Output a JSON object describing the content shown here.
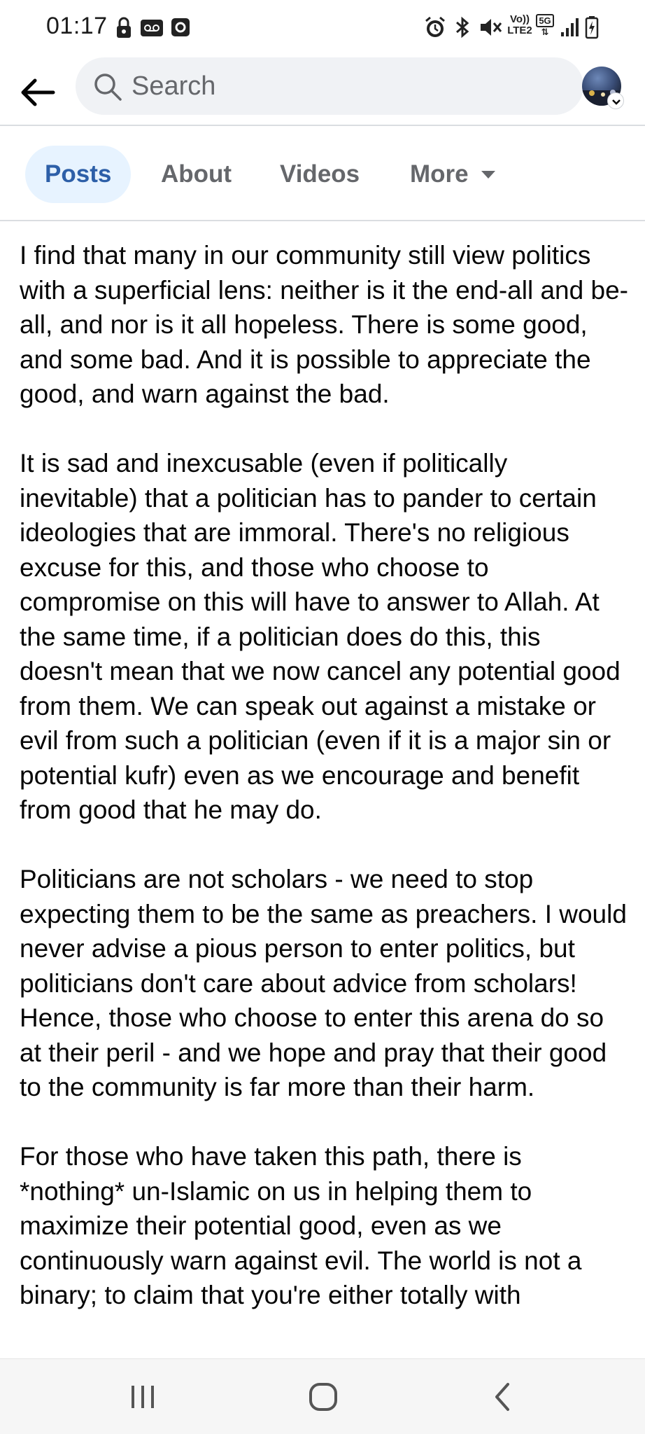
{
  "status_bar": {
    "time": "01:17",
    "left_icons": [
      "lock-icon",
      "voicemail-icon",
      "app-icon"
    ],
    "right_icons": [
      "alarm-icon",
      "bluetooth-icon",
      "mute-icon",
      "volte-icon",
      "5g-icon",
      "signal-icon",
      "battery-icon"
    ],
    "volte_label_top": "Vo))",
    "volte_label_bottom": "LTE2",
    "network_label": "5G"
  },
  "header": {
    "back_icon": "arrow-left-icon",
    "search": {
      "placeholder": "Search",
      "value": ""
    },
    "avatar_icon": "profile-avatar"
  },
  "tabs": [
    {
      "label": "Posts",
      "active": true
    },
    {
      "label": "About",
      "active": false
    },
    {
      "label": "Videos",
      "active": false
    },
    {
      "label": "More",
      "active": false
    }
  ],
  "post": {
    "paragraphs": [
      "I find that many in our community still view politics with a superficial lens: neither is it the end-all and be-all, and nor is it all hopeless. There is some good, and some bad. And it is possible to appreciate the good, and warn against the bad.",
      "It is sad and inexcusable (even if politically inevitable) that a politician has to pander to certain ideologies that are immoral. There's no religious excuse for this, and those who choose to compromise on this will have to answer to Allah. At the same time, if a politician does do this, this doesn't mean that we now cancel any potential good from them. We can speak out against a mistake or evil from such a politician (even if it is a major sin or potential kufr) even as we encourage and benefit from good that he may do.",
      "Politicians are not scholars - we need to stop expecting them to be the same as preachers. I would never advise a pious person to enter politics, but politicians don't care about advice from scholars! Hence, those who choose to enter this arena do so at their peril - and we hope and pray that their good to the community is far more than their harm.",
      "For those who have taken this path, there is *nothing* un-Islamic on us in helping them to maximize their potential good, even as we continuously warn against evil. The world is not a binary; to claim that you're either totally with"
    ]
  },
  "nav_bar": {
    "items": [
      "recent-apps-icon",
      "home-icon",
      "back-icon"
    ]
  },
  "colors": {
    "accent": "#1877f2",
    "tab_active_bg": "#e7f3ff",
    "tab_inactive": "#65676b",
    "search_bg": "#f0f2f5",
    "nav_bg": "#f6f6f6"
  }
}
